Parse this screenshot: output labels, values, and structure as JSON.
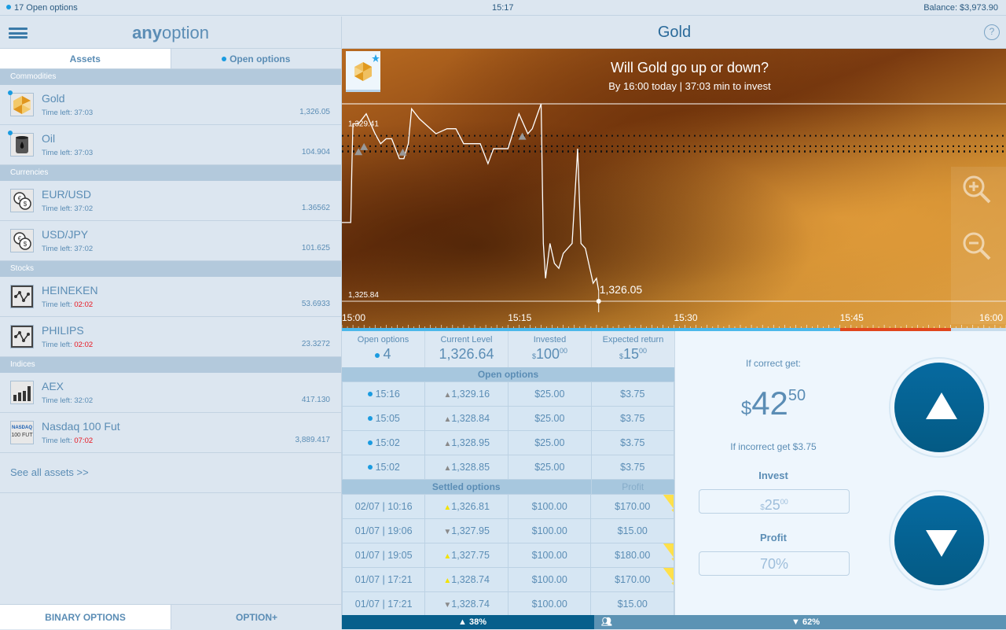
{
  "status": {
    "open_options": "17 Open options",
    "time": "15:17",
    "balance": "Balance: $3,973.90"
  },
  "left": {
    "logo_bold": "any",
    "logo_rest": "option",
    "tabs": [
      "Assets",
      "Open options"
    ],
    "categories": [
      {
        "name": "Commodities",
        "assets": [
          {
            "name": "Gold",
            "time_label": "Time left:",
            "time": "37:03",
            "price": "1,326.05",
            "urgent": false,
            "icon": "gold-icon"
          },
          {
            "name": "Oil",
            "time_label": "Time left:",
            "time": "37:03",
            "price": "104.904",
            "urgent": false,
            "icon": "oil-barrel-icon"
          }
        ]
      },
      {
        "name": "Currencies",
        "assets": [
          {
            "name": "EUR/USD",
            "time_label": "Time left:",
            "time": "37:02",
            "price": "1.36562",
            "urgent": false,
            "icon": "currency-icon"
          },
          {
            "name": "USD/JPY",
            "time_label": "Time left:",
            "time": "37:02",
            "price": "101.625",
            "urgent": false,
            "icon": "currency-icon"
          }
        ]
      },
      {
        "name": "Stocks",
        "assets": [
          {
            "name": "HEINEKEN",
            "time_label": "Time left:",
            "time": "02:02",
            "price": "53.6933",
            "urgent": true,
            "icon": "stock-chart-icon"
          },
          {
            "name": "PHILIPS",
            "time_label": "Time left:",
            "time": "02:02",
            "price": "23.3272",
            "urgent": true,
            "icon": "stock-chart-icon"
          }
        ]
      },
      {
        "name": "Indices",
        "assets": [
          {
            "name": "AEX",
            "time_label": "Time left:",
            "time": "32:02",
            "price": "417.130",
            "urgent": false,
            "icon": "bar-chart-icon"
          },
          {
            "name": "Nasdaq 100 Fut",
            "time_label": "Time left:",
            "time": "07:02",
            "price": "3,889.417",
            "urgent": true,
            "icon": "nasdaq-icon",
            "icon_text": [
              "NASDAQ",
              "100 FUT"
            ]
          }
        ]
      }
    ],
    "see_all": "See all assets >>",
    "bottom_tabs": [
      "BINARY OPTIONS",
      "OPTION+"
    ]
  },
  "main": {
    "title": "Gold",
    "help": "?",
    "question": "Will Gold go up or down?",
    "subtitle": "By 16:00 today | 37:03 min to invest",
    "stats": {
      "open_label": "Open options",
      "open_value": "4",
      "level_label": "Current Level",
      "level_value": "1,326.64",
      "invested_label": "Invested",
      "invested_cur": "$",
      "invested_int": "100",
      "invested_dec": "00",
      "return_label": "Expected return",
      "return_cur": "$",
      "return_int": "15",
      "return_dec": "00"
    },
    "open_header": "Open options",
    "open_rows": [
      {
        "time": "15:16",
        "level": "1,329.16",
        "invested": "$25.00",
        "ret": "$3.75"
      },
      {
        "time": "15:05",
        "level": "1,328.84",
        "invested": "$25.00",
        "ret": "$3.75"
      },
      {
        "time": "15:02",
        "level": "1,328.95",
        "invested": "$25.00",
        "ret": "$3.75"
      },
      {
        "time": "15:02",
        "level": "1,328.85",
        "invested": "$25.00",
        "ret": "$3.75"
      }
    ],
    "settled_header": "Settled options",
    "profit_header": "Profit",
    "settled_rows": [
      {
        "time": "02/07 | 10:16",
        "dir": "up",
        "level": "1,326.81",
        "invested": "$100.00",
        "profit": "$170.00",
        "won": true
      },
      {
        "time": "01/07 | 19:06",
        "dir": "down",
        "level": "1,327.95",
        "invested": "$100.00",
        "profit": "$15.00",
        "won": false
      },
      {
        "time": "01/07 | 19:05",
        "dir": "up",
        "level": "1,327.75",
        "invested": "$100.00",
        "profit": "$180.00",
        "won": true
      },
      {
        "time": "01/07 | 17:21",
        "dir": "up",
        "level": "1,328.74",
        "invested": "$100.00",
        "profit": "$170.00",
        "won": true
      },
      {
        "time": "01/07 | 17:21",
        "dir": "down",
        "level": "1,328.74",
        "invested": "$100.00",
        "profit": "$15.00",
        "won": false
      }
    ],
    "trade": {
      "correct_label": "If correct get:",
      "correct_cur": "$",
      "correct_int": "42",
      "correct_dec": "50",
      "incorrect": "If incorrect get $3.75",
      "invest_label": "Invest",
      "invest_cur": "$",
      "invest_int": "25",
      "invest_dec": "00",
      "profit_label": "Profit",
      "profit_value": "70%"
    },
    "sentiment": {
      "up": "38%",
      "down": "62%",
      "up_fraction": 0.38
    }
  },
  "chart_data": {
    "type": "line",
    "x_ticks": [
      "15:00",
      "15:15",
      "15:30",
      "15:45",
      "16:00"
    ],
    "xlim_minutes": [
      0,
      60
    ],
    "ylim": [
      1325.4,
      1330.2
    ],
    "label_high": "1,329.41",
    "label_low": "1,325.84",
    "current_label": "1,326.05",
    "current": 1326.05,
    "low_line": 1325.84,
    "high_line": 1329.8,
    "option_levels": [
      1329.16,
      1328.84,
      1328.95,
      1328.85
    ],
    "option_markers": [
      [
        1.5,
        1328.85
      ],
      [
        2.0,
        1328.95
      ],
      [
        5.5,
        1328.84
      ],
      [
        16.3,
        1329.16
      ]
    ],
    "time_elapsed_fraction": 0.75,
    "closing_fraction": 0.917,
    "series": [
      [
        0,
        1327.42
      ],
      [
        0.8,
        1327.42
      ],
      [
        0.9,
        1328.5
      ],
      [
        1.0,
        1329.4
      ],
      [
        1.5,
        1329.4
      ],
      [
        2.2,
        1329.6
      ],
      [
        3,
        1329.2
      ],
      [
        3.5,
        1329.0
      ],
      [
        4,
        1329.1
      ],
      [
        4.5,
        1329.1
      ],
      [
        5.2,
        1328.7
      ],
      [
        5.6,
        1328.7
      ],
      [
        6,
        1329.0
      ],
      [
        6.3,
        1329.7
      ],
      [
        7,
        1329.5
      ],
      [
        8.5,
        1329.2
      ],
      [
        9.5,
        1329.3
      ],
      [
        10.3,
        1329.3
      ],
      [
        11,
        1329.0
      ],
      [
        12.5,
        1329.0
      ],
      [
        13.2,
        1328.6
      ],
      [
        13.7,
        1328.9
      ],
      [
        15,
        1328.9
      ],
      [
        16,
        1329.6
      ],
      [
        16.8,
        1329.2
      ],
      [
        17.2,
        1329.3
      ],
      [
        18,
        1329.8
      ],
      [
        18.2,
        1327.0
      ],
      [
        18.4,
        1326.3
      ],
      [
        18.8,
        1327.0
      ],
      [
        19.2,
        1326.6
      ],
      [
        19.6,
        1326.5
      ],
      [
        20,
        1326.8
      ],
      [
        20.4,
        1326.9
      ],
      [
        20.8,
        1327.0
      ],
      [
        21.3,
        1328.9
      ],
      [
        21.6,
        1327.0
      ],
      [
        22,
        1326.9
      ],
      [
        22.4,
        1326.5
      ],
      [
        22.7,
        1326.2
      ],
      [
        23,
        1326.3
      ],
      [
        23.2,
        1326.05
      ]
    ]
  }
}
